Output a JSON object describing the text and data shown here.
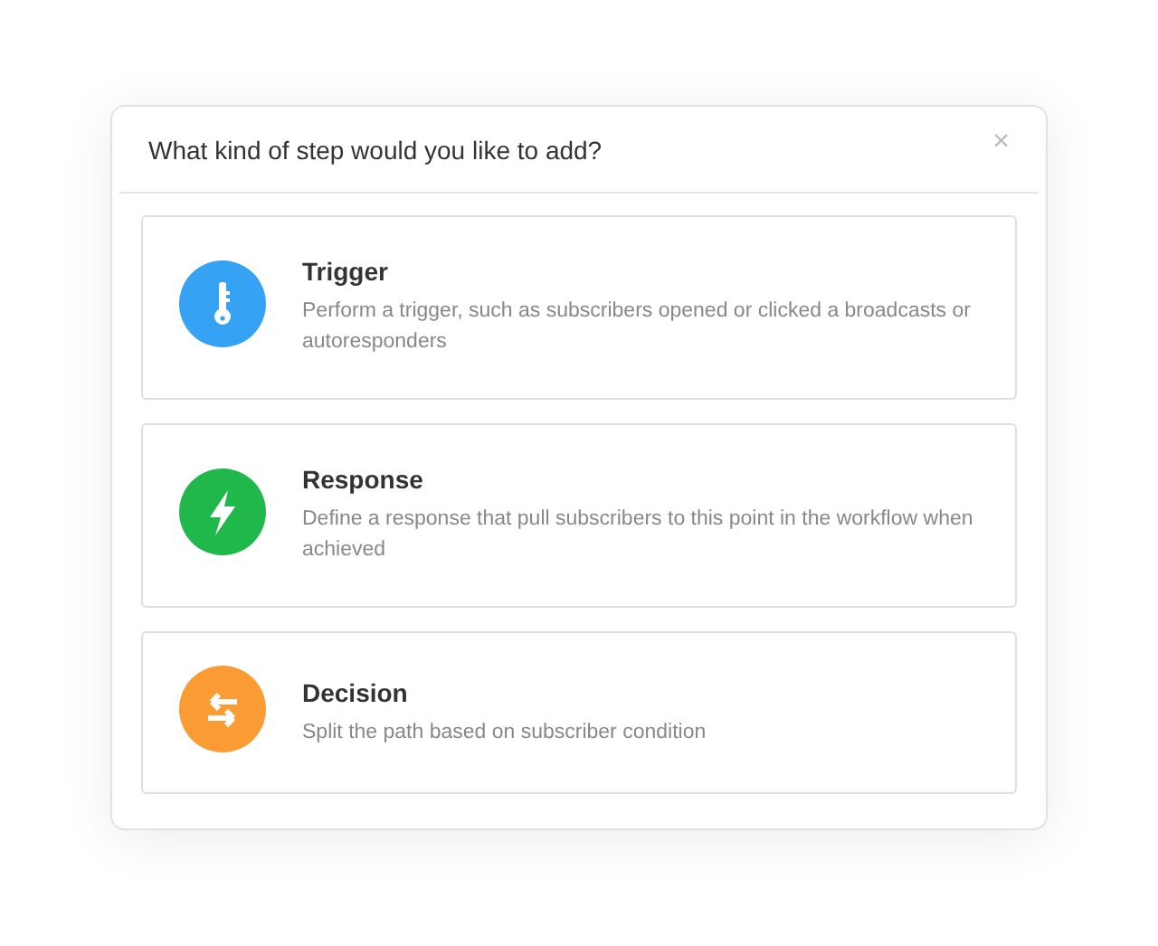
{
  "dialog": {
    "title": "What kind of step would you like to add?",
    "close": "×"
  },
  "options": [
    {
      "kind": "trigger",
      "color": "#35a2f4",
      "title": "Trigger",
      "description": "Perform a trigger, such as subscribers opened or clicked a broadcasts or autoresponders"
    },
    {
      "kind": "response",
      "color": "#20b84a",
      "title": "Response",
      "description": "Define a response that pull subscribers to this point in the workflow when achieved"
    },
    {
      "kind": "decision",
      "color": "#fb9b34",
      "title": "Decision",
      "description": "Split the path based on subscriber condition"
    }
  ]
}
